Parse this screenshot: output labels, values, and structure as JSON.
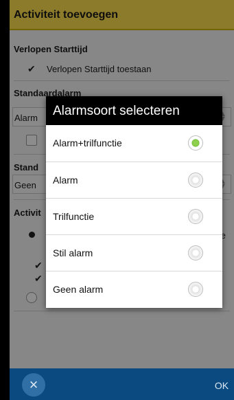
{
  "appbar": {
    "title": "Activiteit toevoegen"
  },
  "sections": {
    "past_start": {
      "header": "Verlopen Starttijd",
      "toggle_label": "Verlopen Starttijd toestaan",
      "checkmark": "✔"
    },
    "default_alarm": {
      "header": "Standaardalarm",
      "spinner_value": "Alarm"
    },
    "default_sound": {
      "header": "Stand",
      "spinner_value": "Geen"
    },
    "activity": {
      "header": "Activit",
      "partial_text": "ave",
      "checkmark": "✔"
    }
  },
  "dialog": {
    "title": "Alarmsoort selecteren",
    "options": [
      {
        "label": "Alarm+trilfunctie",
        "selected": true
      },
      {
        "label": "Alarm",
        "selected": false
      },
      {
        "label": "Trilfunctie",
        "selected": false
      },
      {
        "label": "Stil alarm",
        "selected": false
      },
      {
        "label": "Geen alarm",
        "selected": false
      }
    ]
  },
  "bottombar": {
    "cancel_icon": "×",
    "ok_label": "OK"
  },
  "colors": {
    "appbar": "#ffe14d",
    "bottombar": "#0b4a80",
    "selected_radio": "#7cc63a"
  }
}
